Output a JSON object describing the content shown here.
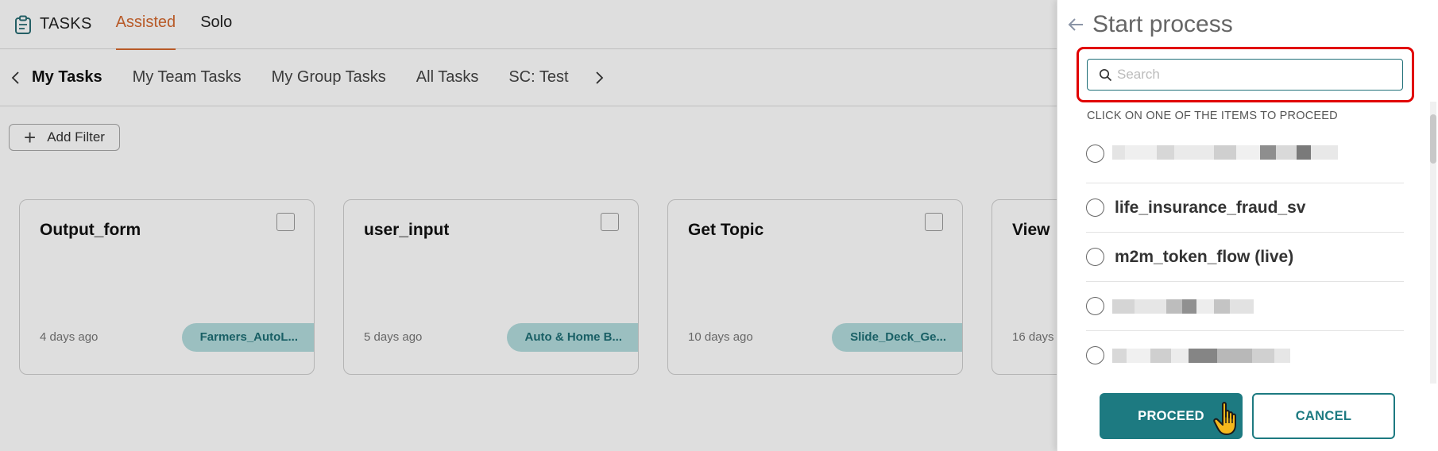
{
  "header": {
    "brand": "TASKS",
    "mode_tabs": [
      {
        "label": "Assisted",
        "active": true
      },
      {
        "label": "Solo",
        "active": false
      }
    ]
  },
  "views": {
    "tabs": [
      "My Tasks",
      "My Team Tasks",
      "My Group Tasks",
      "All Tasks",
      "SC: Test"
    ],
    "active": "My Tasks"
  },
  "filter": {
    "label": "Add Filter"
  },
  "cards": [
    {
      "title": "Output_form",
      "time": "4 days ago",
      "tag": "Farmers_AutoL..."
    },
    {
      "title": "user_input",
      "time": "5 days ago",
      "tag": "Auto & Home B..."
    },
    {
      "title": "Get Topic",
      "time": "10 days ago",
      "tag": "Slide_Deck_Ge..."
    },
    {
      "title": "View",
      "time": "16 days",
      "tag": ""
    }
  ],
  "panel": {
    "title": "Start process",
    "search": {
      "placeholder": "Search",
      "value": ""
    },
    "hint": "CLICK ON ONE OF THE ITEMS TO PROCEED",
    "items": [
      {
        "label": "",
        "redacted": true
      },
      {
        "label": "life_insurance_fraud_sv",
        "redacted": false
      },
      {
        "label": "m2m_token_flow (live)",
        "redacted": false
      },
      {
        "label": "",
        "redacted": true
      },
      {
        "label": "",
        "redacted": true
      }
    ],
    "proceed_label": "PROCEED",
    "cancel_label": "CANCEL"
  },
  "colors": {
    "accent": "#1d7a81",
    "active_tab": "#d4682e",
    "highlight": "#e10000",
    "tag_bg": "#b2dcdd"
  },
  "icons": [
    "clipboard-icon",
    "chevron-left-icon",
    "chevron-right-icon",
    "plus-icon",
    "back-arrow-icon",
    "search-icon",
    "hand-pointer-icon"
  ]
}
